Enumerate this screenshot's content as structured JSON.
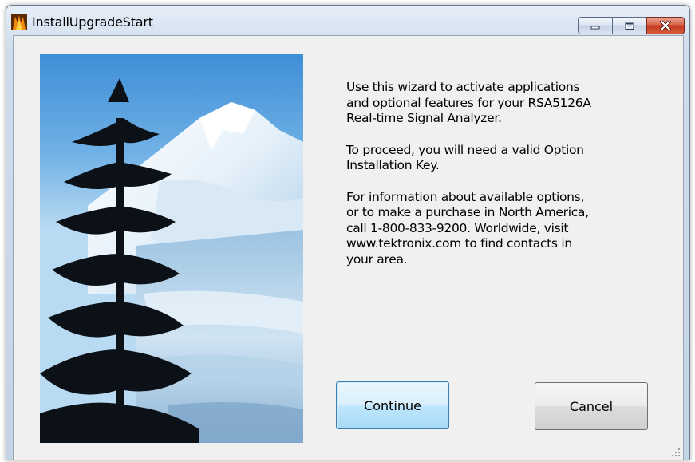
{
  "window": {
    "title": "InstallUpgradeStart"
  },
  "message": {
    "paragraphs": [
      "Use this wizard to activate applications\nand optional features for your RSA5126A\nReal-time Signal Analyzer.",
      "To proceed, you will need a valid Option\nInstallation Key.",
      "For information about available options,\nor to make a purchase in North America,\ncall 1-800-833-9200. Worldwide, visit\nwww.tektronix.com to find contacts in\nyour area."
    ]
  },
  "buttons": {
    "continue_label": "Continue",
    "cancel_label": "Cancel"
  },
  "icons": {
    "app": "tektronix-logo-icon",
    "minimize": "minimize-icon",
    "maximize": "maximize-icon",
    "close": "close-icon",
    "grip": "resize-grip-icon"
  },
  "colors": {
    "close_button": "#c33a1e",
    "default_button_border": "#3c7fb1",
    "dialog_background": "#f0f0f0"
  }
}
